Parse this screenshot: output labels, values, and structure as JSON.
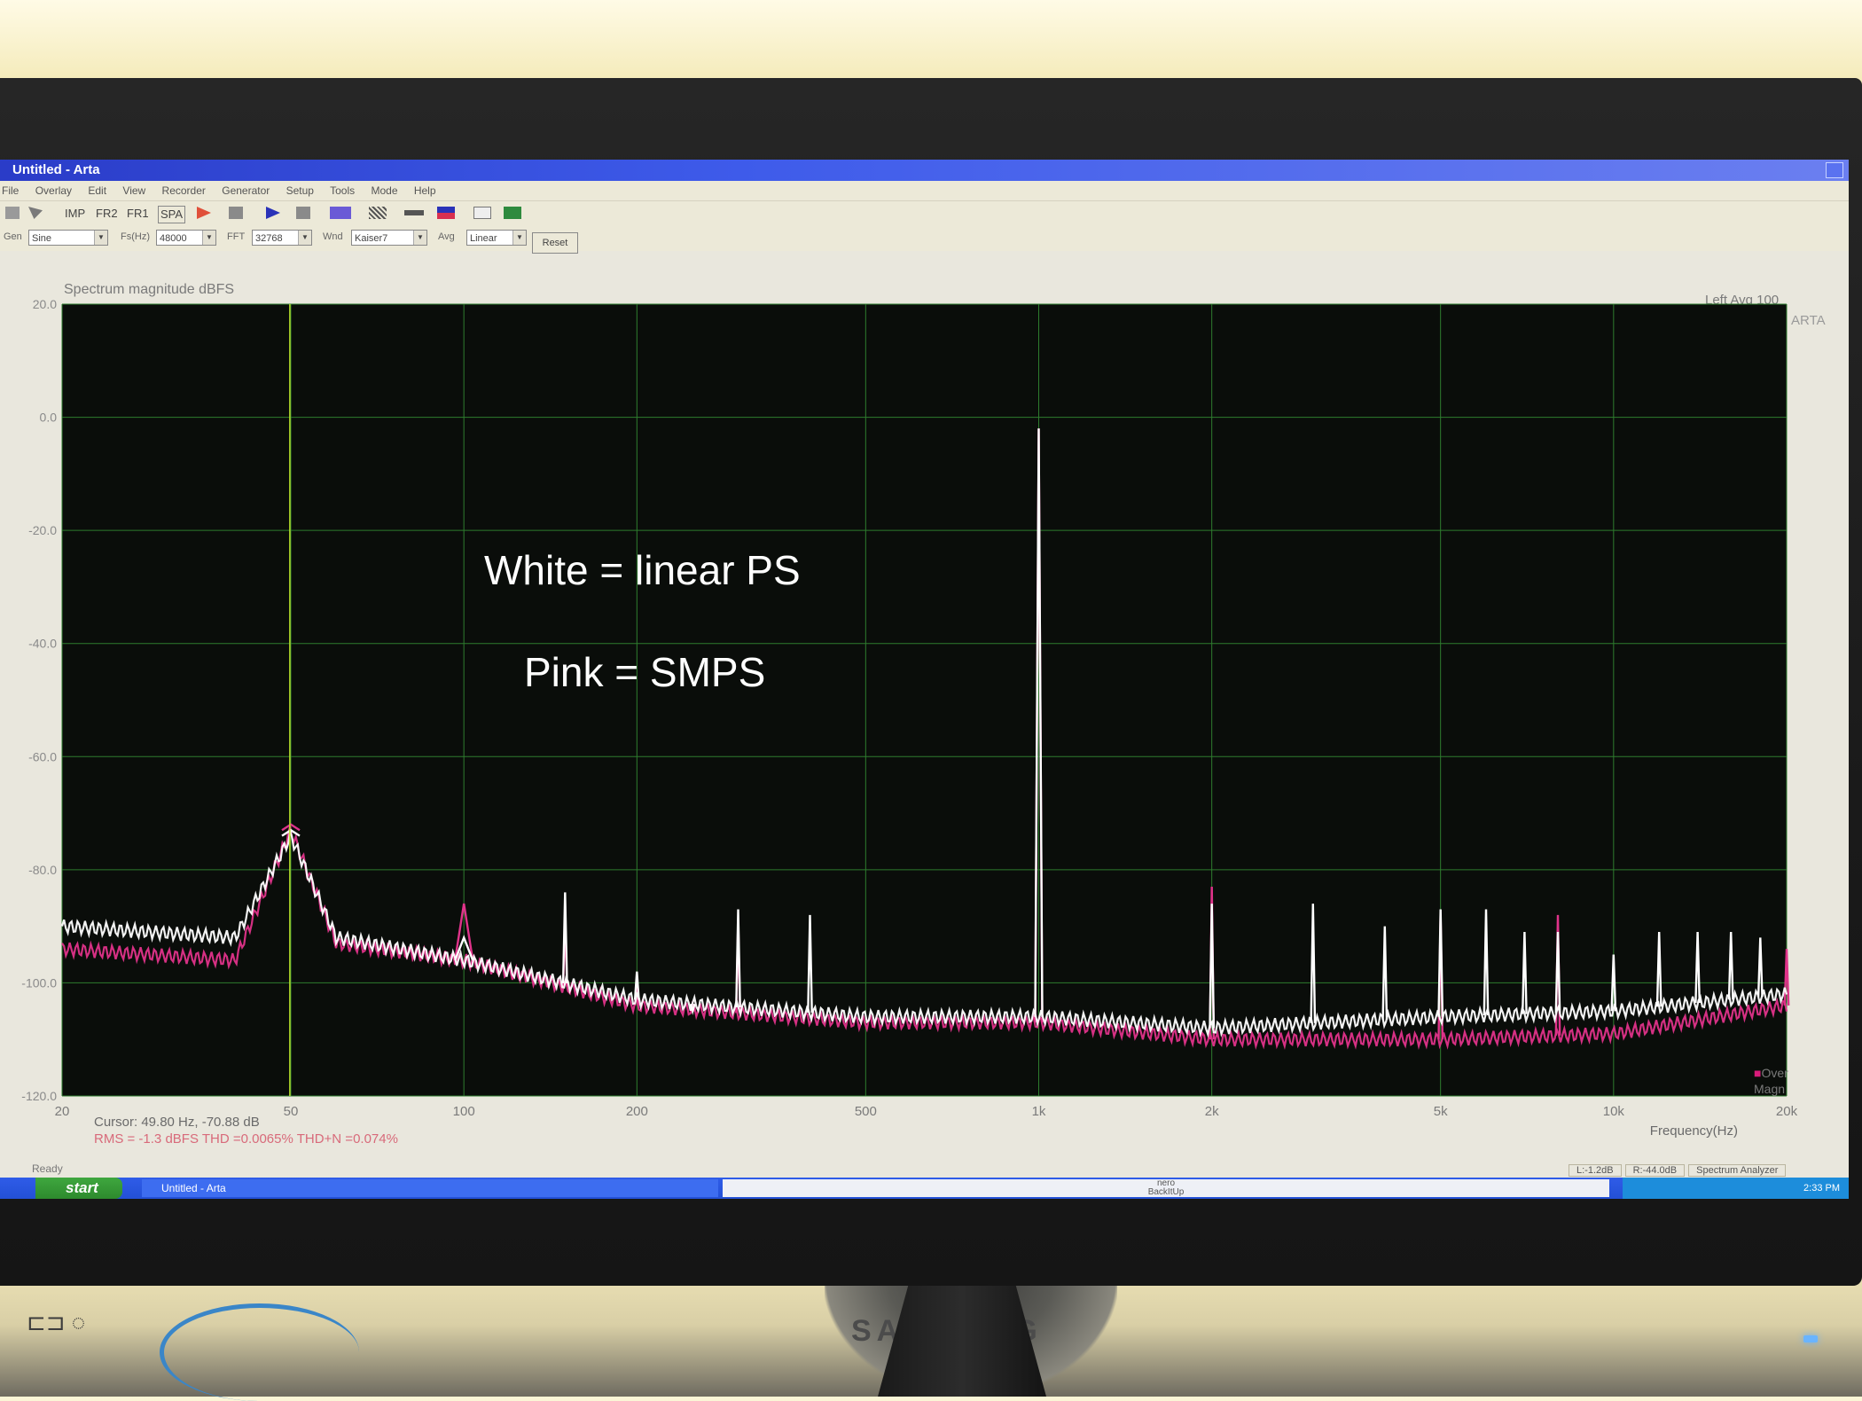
{
  "window": {
    "title": "Untitled - Arta"
  },
  "menu": [
    "File",
    "Overlay",
    "Edit",
    "View",
    "Recorder",
    "Generator",
    "Setup",
    "Tools",
    "Mode",
    "Help"
  ],
  "toolbar": {
    "imp": "IMP",
    "fr2": "FR2",
    "fr1": "FR1",
    "spa": "SPA"
  },
  "controls": {
    "gen_label": "Gen",
    "gen_value": "Sine",
    "fs_label": "Fs(Hz)",
    "fs_value": "48000",
    "fft_label": "FFT",
    "fft_value": "32768",
    "wnd_label": "Wnd",
    "wnd_value": "Kaiser7",
    "avg_label": "Avg",
    "avg_value": "Linear",
    "reset_label": "Reset"
  },
  "plot": {
    "title": "Spectrum magnitude dBFS",
    "status": "Left  Avg 100",
    "logo": "ARTA",
    "overload_marker": "Over",
    "overload_sub": "Magn",
    "cursor": "Cursor: 49.80 Hz, -70.88 dB",
    "measurements": "RMS =  -1.3 dBFS   THD =0.0065%   THD+N =0.074%"
  },
  "annotations": {
    "white": "White = linear PS",
    "pink": "Pink = SMPS"
  },
  "status": {
    "ready": "Ready",
    "left_level": "L:-1.2dB",
    "right_level": "R:-44.0dB",
    "mode": "Spectrum Analyzer"
  },
  "taskbar": {
    "start": "start",
    "task": "Untitled - Arta",
    "nero": "nero",
    "nero_sub": "BackItUp",
    "clock": "2:33 PM"
  },
  "bezel": {
    "brand": "SAMSUNG"
  },
  "chart_data": {
    "type": "line",
    "title": "Spectrum magnitude dBFS",
    "xlabel": "Frequency(Hz)",
    "ylabel": "",
    "x_scale": "log",
    "xlim": [
      20,
      20000
    ],
    "ylim": [
      -120,
      20
    ],
    "x_ticks": [
      20,
      50,
      100,
      200,
      500,
      1000,
      2000,
      5000,
      10000,
      20000
    ],
    "x_tick_labels": [
      "20",
      "50",
      "100",
      "200",
      "500",
      "1k",
      "2k",
      "5k",
      "10k",
      "20k"
    ],
    "y_ticks": [
      20,
      0,
      -20,
      -40,
      -60,
      -80,
      -100,
      -120
    ],
    "y_tick_labels": [
      "20.0",
      "0.0",
      "-20.0",
      "-40.0",
      "-60.0",
      "-80.0",
      "-100.0",
      "-120.0"
    ],
    "grid": true,
    "cursor_x": 49.8,
    "background": "#0a0d0a",
    "grid_color": "#2e7d2e",
    "cursor_color": "#b8e02a",
    "series": [
      {
        "color": "#ffffff",
        "floor": [
          [
            20,
            -90
          ],
          [
            40,
            -92
          ],
          [
            50,
            -74
          ],
          [
            60,
            -92
          ],
          [
            100,
            -96
          ],
          [
            200,
            -103
          ],
          [
            500,
            -106
          ],
          [
            1000,
            -106
          ],
          [
            2000,
            -108
          ],
          [
            5000,
            -106
          ],
          [
            10000,
            -105
          ],
          [
            20000,
            -102
          ]
        ],
        "peaks": [
          [
            50,
            -73
          ],
          [
            100,
            -92
          ],
          [
            150,
            -84
          ],
          [
            200,
            -98
          ],
          [
            250,
            -105
          ],
          [
            300,
            -87
          ],
          [
            400,
            -88
          ],
          [
            1000,
            -2
          ],
          [
            2000,
            -86
          ],
          [
            3000,
            -86
          ],
          [
            4000,
            -90
          ],
          [
            5000,
            -87
          ],
          [
            6000,
            -87
          ],
          [
            7000,
            -91
          ],
          [
            8000,
            -91
          ],
          [
            10000,
            -95
          ],
          [
            12000,
            -91
          ],
          [
            14000,
            -91
          ],
          [
            16000,
            -91
          ],
          [
            18000,
            -92
          ]
        ]
      },
      {
        "color": "#e0338a",
        "floor": [
          [
            20,
            -94
          ],
          [
            40,
            -96
          ],
          [
            50,
            -73
          ],
          [
            60,
            -93
          ],
          [
            100,
            -96
          ],
          [
            200,
            -104
          ],
          [
            500,
            -107
          ],
          [
            1000,
            -107
          ],
          [
            2000,
            -110
          ],
          [
            5000,
            -110
          ],
          [
            10000,
            -109
          ],
          [
            20000,
            -104
          ]
        ],
        "peaks": [
          [
            50,
            -72
          ],
          [
            100,
            -86
          ],
          [
            150,
            -89
          ],
          [
            200,
            -100
          ],
          [
            250,
            -105
          ],
          [
            300,
            -89
          ],
          [
            1000,
            -2
          ],
          [
            2000,
            -83
          ],
          [
            5000,
            -88
          ],
          [
            8000,
            -88
          ],
          [
            20000,
            -94
          ]
        ]
      }
    ]
  }
}
